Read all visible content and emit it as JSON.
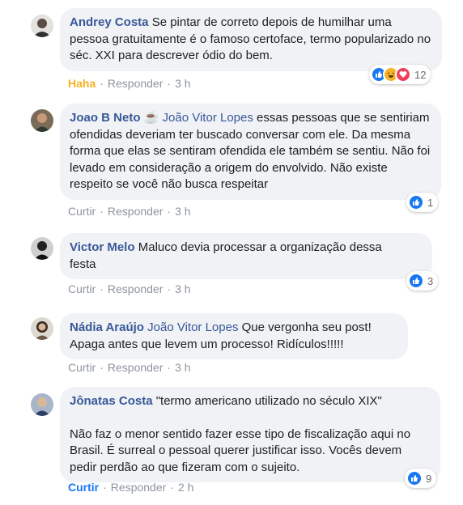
{
  "comments": [
    {
      "author": "Andrey Costa",
      "mention": "",
      "text": "Se pintar de correto depois de humilhar uma pessoa gratuitamente é o famoso certoface, termo popularizado no séc. XXI para descrever ódio do bem.",
      "action": "Haha",
      "reply": "Responder",
      "time": "3 h",
      "reactions": [
        "like-icon",
        "haha-icon",
        "love-icon"
      ],
      "count": "12"
    },
    {
      "author": "Joao B Neto",
      "badge": "☕",
      "mention": "João Vitor Lopes",
      "text": "essas pessoas que se sentiriam ofendidas deveriam ter buscado conversar com ele. Da mesma forma que elas se sentiram ofendida ele também se sentiu. Não foi levado em consideração a origem do envolvido. Não existe respeito se você não busca respeitar",
      "action": "Curtir",
      "reply": "Responder",
      "time": "3 h",
      "reactions": [
        "like-icon"
      ],
      "count": "1"
    },
    {
      "author": "Victor Melo",
      "mention": "",
      "text": "Maluco devia processar a organização dessa festa",
      "action": "Curtir",
      "reply": "Responder",
      "time": "3 h",
      "reactions": [
        "like-icon"
      ],
      "count": "3"
    },
    {
      "author": "Nádia Araújo",
      "mention": "João Vitor Lopes",
      "text": "Que vergonha seu post! Apaga antes que levem um processo! Ridículos!!!!!",
      "action": "Curtir",
      "reply": "Responder",
      "time": "3 h"
    },
    {
      "author": "Jônatas Costa",
      "mention": "",
      "text": "\"termo americano utilizado no século XIX\"",
      "text2": "Não faz o menor sentido fazer esse tipo de fiscalização aqui no Brasil. É surreal o pessoal querer justificar isso. Vocês devem pedir perdão ao que fizeram com o sujeito.",
      "action": "Curtir",
      "reply": "Responder",
      "time": "2 h",
      "reactions": [
        "like-icon"
      ],
      "count": "9"
    }
  ],
  "colors": {
    "author": "#385898",
    "bubble": "#f0f2f5",
    "meta": "#8d949e",
    "like": "#1877f2",
    "haha": "#f7b125",
    "love": "#f33e58"
  }
}
